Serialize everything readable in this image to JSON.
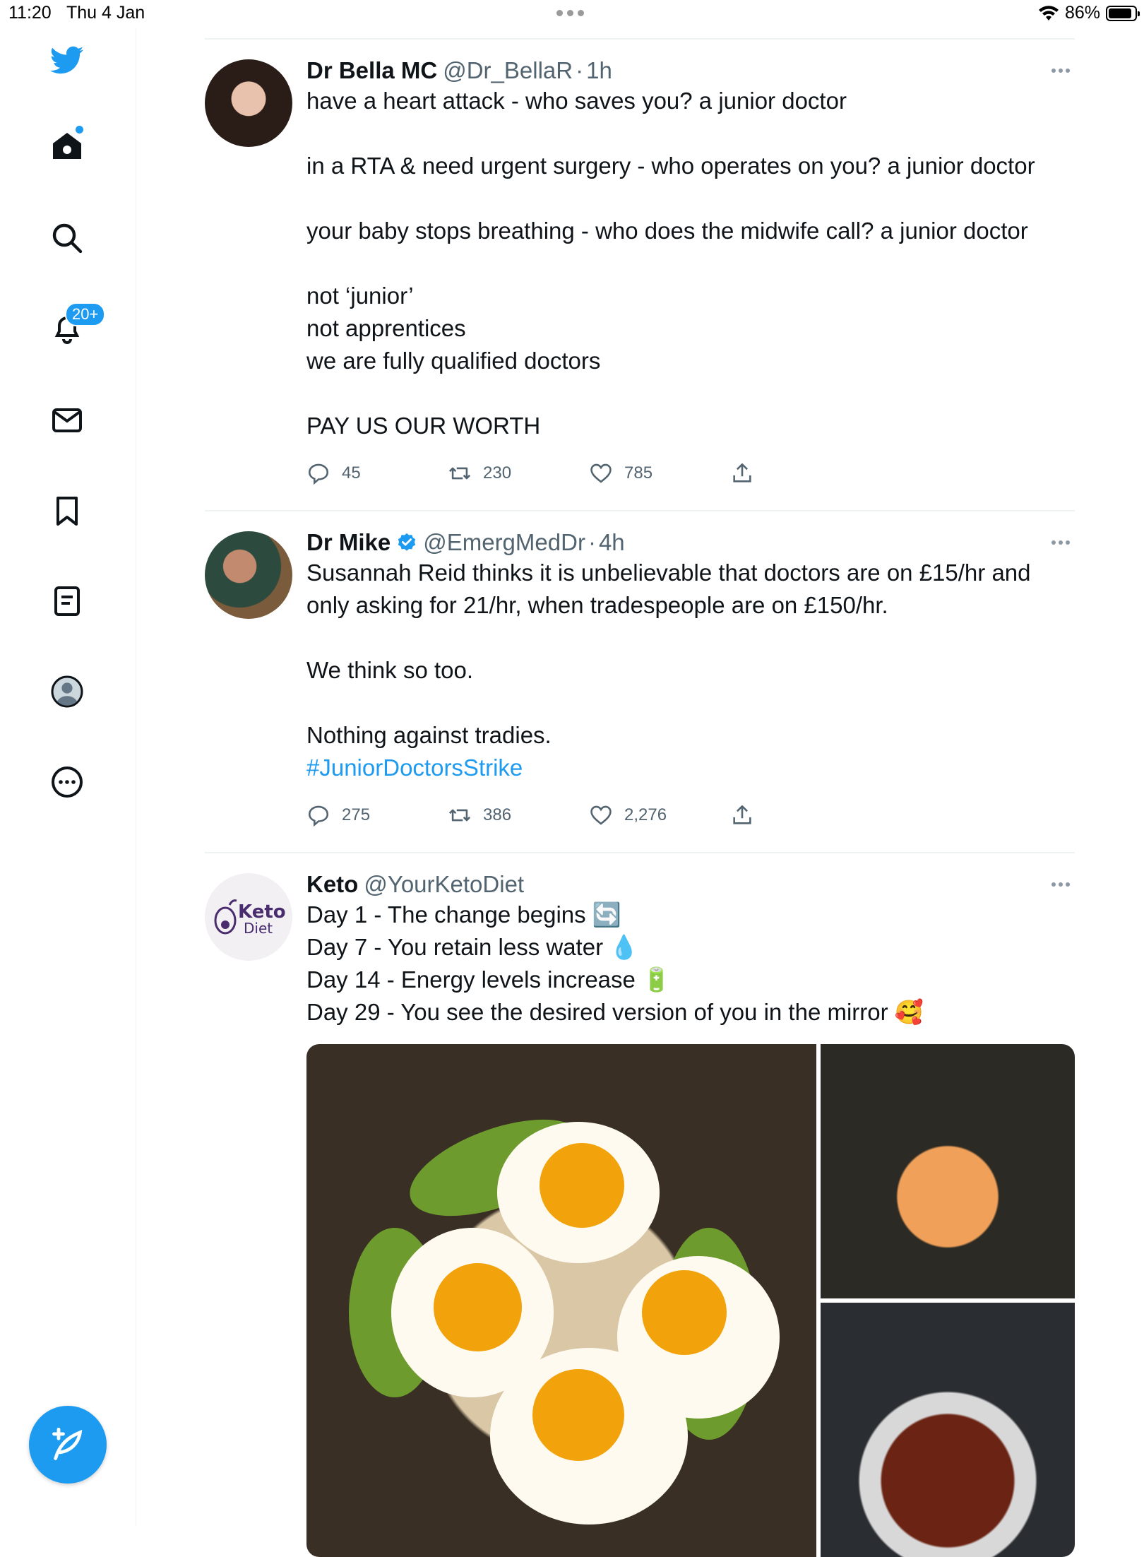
{
  "status_bar": {
    "time": "11:20",
    "date": "Thu 4 Jan",
    "battery": "86%"
  },
  "sidebar": {
    "notifications_badge": "20+",
    "items": [
      "twitter-logo",
      "home",
      "search",
      "notifications",
      "messages",
      "bookmarks",
      "lists",
      "profile",
      "more"
    ]
  },
  "tweets": [
    {
      "name": "Dr Bella MC",
      "handle": "@Dr_BellaR",
      "dot": "·",
      "time": "1h",
      "text": "have a heart attack - who saves you? a junior doctor\n\nin a RTA & need urgent surgery - who operates on you? a junior doctor\n\nyour baby stops breathing - who does the midwife call? a junior doctor\n\nnot ‘junior’\nnot apprentices\nwe are fully qualified doctors\n\nPAY US OUR WORTH",
      "replies": "45",
      "retweets": "230",
      "likes": "785"
    },
    {
      "name": "Dr Mike",
      "handle": "@EmergMedDr",
      "dot": "·",
      "time": "4h",
      "verified": true,
      "text": "Susannah Reid thinks it is unbelievable that doctors are on £15/hr and only asking for 21/hr, when tradespeople are on £150/hr.\n\nWe think so too.\n\nNothing against tradies.",
      "hashtag": "#JuniorDoctorsStrike",
      "replies": "275",
      "retweets": "386",
      "likes": "2,276"
    },
    {
      "name": "Keto",
      "handle": "@YourKetoDiet",
      "avatar_text_1": "Keto",
      "avatar_text_2": "Diet",
      "text": "Day 1 - The change begins 🔄\nDay 7 - You retain less water 💧\nDay 14 - Energy levels increase 🔋\nDay 29 - You see the desired version of you in the mirror 🥰"
    }
  ],
  "colors": {
    "accent": "#1d9bf0",
    "text": "#0f1419",
    "muted": "#536471",
    "divider": "#eff3f4"
  }
}
